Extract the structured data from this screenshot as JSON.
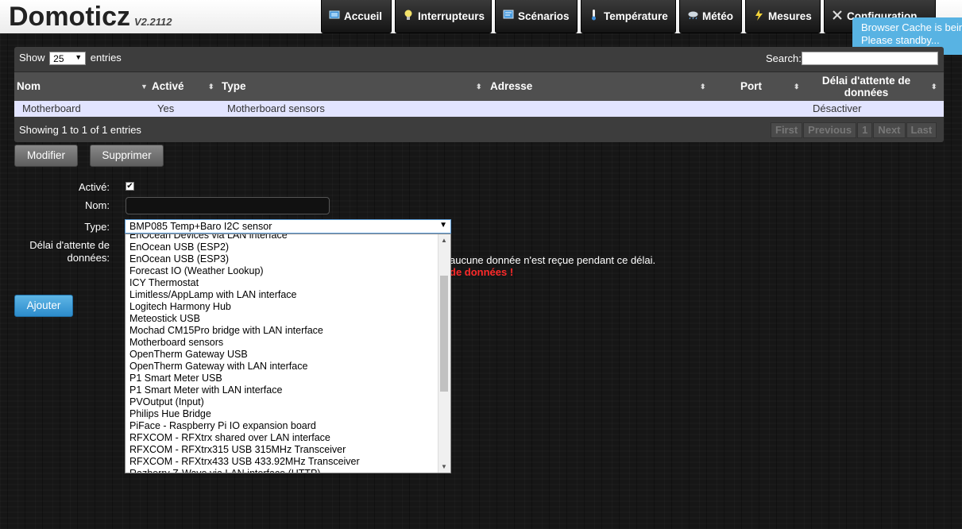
{
  "app": {
    "name": "Domoticz",
    "version": "V2.2112"
  },
  "nav": [
    {
      "label": "Accueil",
      "icon": "home-icon"
    },
    {
      "label": "Interrupteurs",
      "icon": "lightbulb-icon"
    },
    {
      "label": "Scénarios",
      "icon": "scenes-icon"
    },
    {
      "label": "Température",
      "icon": "thermometer-icon"
    },
    {
      "label": "Météo",
      "icon": "weather-icon"
    },
    {
      "label": "Mesures",
      "icon": "lightning-icon"
    },
    {
      "label": "Configuration",
      "icon": "tools-icon"
    }
  ],
  "notification": {
    "line1": "Browser Cache is being cleared",
    "line2": "Please standby..."
  },
  "table": {
    "show_label": "Show",
    "page_size": "25",
    "entries_label": "entries",
    "search_label": "Search:",
    "columns": [
      "Nom",
      "Activé",
      "Type",
      "Adresse",
      "Port",
      "Délai d'attente de",
      "données"
    ],
    "rows": [
      {
        "nom": "Motherboard",
        "active": "Yes",
        "type": "Motherboard sensors",
        "adresse": "",
        "port": "",
        "delai": "Désactiver"
      }
    ],
    "info": "Showing 1 to 1 of 1 entries",
    "pager": [
      "First",
      "Previous",
      "1",
      "Next",
      "Last"
    ]
  },
  "actions": {
    "modify": "Modifier",
    "delete": "Supprimer",
    "add": "Ajouter"
  },
  "form": {
    "active_label": "Activé:",
    "name_label": "Nom:",
    "type_label": "Type:",
    "timeout_label_1": "Délai d'attente de",
    "timeout_label_2": "données:",
    "type_selected": "BMP085 Temp+Baro I2C sensor",
    "hint": "aucune donnée n'est reçue pendant ce délai.",
    "warning": "de données !"
  },
  "dropdown_options": [
    "EnOcean Devices via LAN interface",
    "EnOcean USB (ESP2)",
    "EnOcean USB (ESP3)",
    "Forecast IO (Weather Lookup)",
    "ICY Thermostat",
    "Limitless/AppLamp with LAN interface",
    "Logitech Harmony Hub",
    "Meteostick USB",
    "Mochad CM15Pro bridge with LAN interface",
    "Motherboard sensors",
    "OpenTherm Gateway USB",
    "OpenTherm Gateway with LAN interface",
    "P1 Smart Meter USB",
    "P1 Smart Meter with LAN interface",
    "PVOutput (Input)",
    "Philips Hue Bridge",
    "PiFace - Raspberry Pi IO expansion board",
    "RFXCOM - RFXtrx shared over LAN interface",
    "RFXCOM - RFXtrx315 USB 315MHz Transceiver",
    "RFXCOM - RFXtrx433 USB 433.92MHz Transceiver",
    "Razberry Z-Wave via LAN interface (HTTP)"
  ],
  "colors": {
    "accent_blue": "#58b3e3",
    "row_bg": "#e2e4ff",
    "warning_red": "#ff2a2a"
  }
}
